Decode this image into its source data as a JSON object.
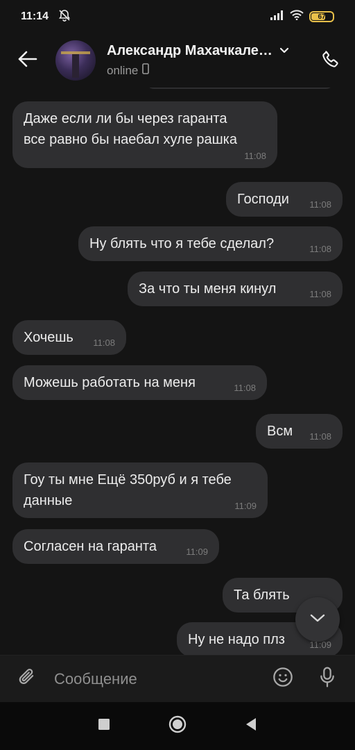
{
  "status_bar": {
    "time": "11:14",
    "battery_level": "67"
  },
  "header": {
    "contact_name": "Александр Махачкале…",
    "status": "online",
    "icons": [
      "back-arrow-icon",
      "chevron-down-icon",
      "mobile-device-icon",
      "phone-icon"
    ]
  },
  "messages": [
    {
      "direction": "incoming",
      "lines": [
        "Даже если ли бы через гаранта",
        "все равно бы наебал хуле рашка"
      ],
      "time": "11:08"
    },
    {
      "direction": "outgoing",
      "lines": [
        "Господи"
      ],
      "time": "11:08"
    },
    {
      "direction": "outgoing",
      "lines": [
        "Ну блять что я тебе сделал?"
      ],
      "time": "11:08"
    },
    {
      "direction": "outgoing",
      "lines": [
        "За что ты меня кинул"
      ],
      "time": "11:08"
    },
    {
      "direction": "incoming",
      "lines": [
        "Хочешь"
      ],
      "time": "11:08"
    },
    {
      "direction": "incoming",
      "lines": [
        "Можешь работать на меня"
      ],
      "time": "11:08"
    },
    {
      "direction": "outgoing",
      "lines": [
        "Всм"
      ],
      "time": "11:08"
    },
    {
      "direction": "incoming",
      "lines": [
        "Гоу ты мне Ещё 350руб и я тебе",
        "данные"
      ],
      "time": "11:09"
    },
    {
      "direction": "incoming",
      "lines": [
        "Согласен на гаранта"
      ],
      "time": "11:09"
    },
    {
      "direction": "outgoing",
      "lines": [
        "Та блять"
      ],
      "time": ""
    },
    {
      "direction": "outgoing",
      "lines": [
        "Ну не надо плз"
      ],
      "time": "11:09"
    }
  ],
  "composer": {
    "placeholder": "Сообщение",
    "icons": [
      "paperclip-icon",
      "emoji-icon",
      "microphone-icon"
    ]
  },
  "colors": {
    "background": "#141414",
    "bubble": "#2f2f31",
    "text": "#ececec",
    "timestamp": "#7c7c7c",
    "battery": "#e8c04a"
  }
}
